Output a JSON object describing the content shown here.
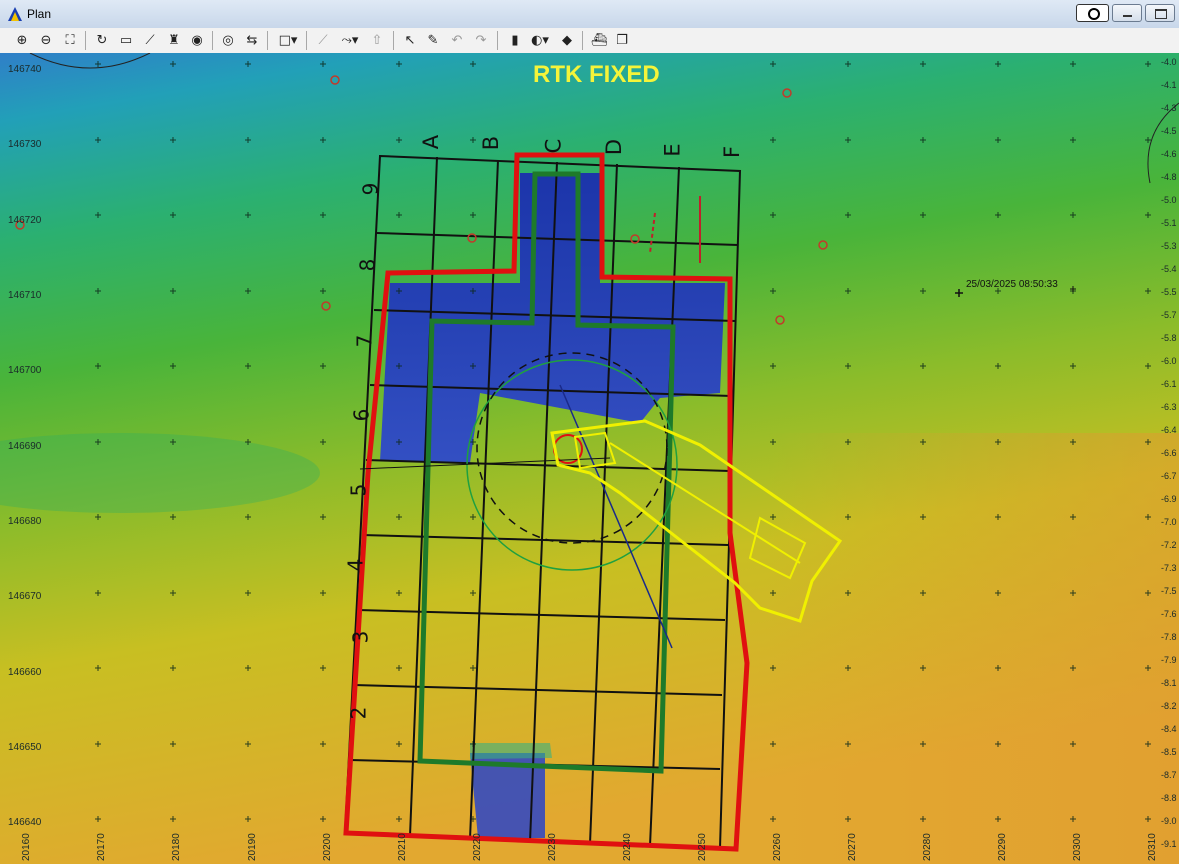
{
  "window": {
    "title": "Plan"
  },
  "toolbar": {
    "buttons": [
      {
        "id": "zoom-in",
        "glyph": "⊕"
      },
      {
        "id": "zoom-out",
        "glyph": "⊖"
      },
      {
        "id": "zoom-extent",
        "glyph": "⛶"
      },
      {
        "id": "rotate",
        "glyph": "↻"
      },
      {
        "id": "measure",
        "glyph": "▭"
      },
      {
        "id": "profile",
        "glyph": "⟋"
      },
      {
        "id": "marker",
        "glyph": "♜"
      },
      {
        "id": "layers",
        "glyph": "◉"
      },
      {
        "id": "track",
        "glyph": "◎"
      },
      {
        "id": "grid-toggle",
        "glyph": "⇆"
      },
      {
        "id": "select-rect",
        "glyph": "□▾"
      },
      {
        "id": "draw-line",
        "glyph": "⟋"
      },
      {
        "id": "route",
        "glyph": "⤳▾"
      },
      {
        "id": "waypoint",
        "glyph": "⇧"
      },
      {
        "id": "pointer",
        "glyph": "↖"
      },
      {
        "id": "edit",
        "glyph": "✎"
      },
      {
        "id": "undo",
        "glyph": "↶"
      },
      {
        "id": "redo",
        "glyph": "↷"
      },
      {
        "id": "color-scale",
        "glyph": "▮"
      },
      {
        "id": "color-settings",
        "glyph": "◐▾"
      },
      {
        "id": "surface",
        "glyph": "◆"
      },
      {
        "id": "vessel",
        "glyph": "⛴"
      },
      {
        "id": "windows",
        "glyph": "❐"
      }
    ]
  },
  "map": {
    "status_text": "RTK FIXED",
    "timestamp": "25/03/2025 08:50:33",
    "northing_labels": [
      "146740",
      "146730",
      "146720",
      "146710",
      "146700",
      "146690",
      "146680",
      "146670",
      "146660",
      "146650",
      "146640"
    ],
    "easting_labels": [
      "20160",
      "20170",
      "20180",
      "20190",
      "20200",
      "20210",
      "20220",
      "20230",
      "20240",
      "20250",
      "20260",
      "20270",
      "20280",
      "20290",
      "20300",
      "20310"
    ],
    "depth_scale": [
      "-4.0",
      "-4.1",
      "-4.3",
      "-4.5",
      "-4.6",
      "-4.8",
      "-5.0",
      "-5.1",
      "-5.3",
      "-5.4",
      "-5.5",
      "-5.7",
      "-5.8",
      "-6.0",
      "-6.1",
      "-6.3",
      "-6.4",
      "-6.6",
      "-6.7",
      "-6.9",
      "-7.0",
      "-7.2",
      "-7.3",
      "-7.5",
      "-7.6",
      "-7.8",
      "-7.9",
      "-8.1",
      "-8.2",
      "-8.4",
      "-8.5",
      "-8.7",
      "-8.8",
      "-9.0",
      "-9.1"
    ],
    "grid_columns": [
      "A",
      "B",
      "C",
      "D",
      "E",
      "F"
    ],
    "grid_rows": [
      "9",
      "8",
      "7",
      "6",
      "5",
      "4",
      "3",
      "2"
    ],
    "colors": {
      "shallow": "#2f7fc8",
      "mid": "#3cb043",
      "deep": "#e0b030",
      "excavation": "#1f2fb8",
      "outer_boundary": "#e01010",
      "inner_boundary": "#1e7a2a",
      "vessel": "#f0f000",
      "status": "#f4f43a"
    }
  }
}
